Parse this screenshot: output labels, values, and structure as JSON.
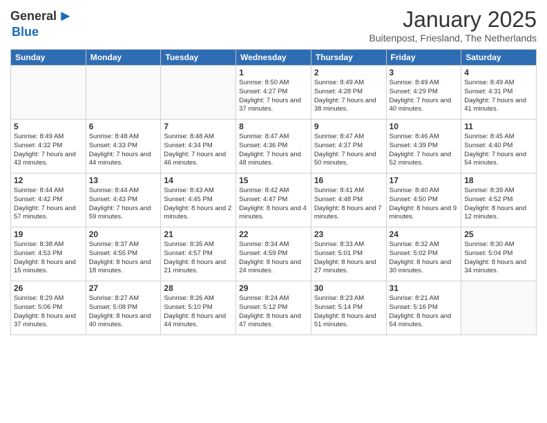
{
  "header": {
    "logo_general": "General",
    "logo_blue": "Blue",
    "title": "January 2025",
    "location": "Buitenpost, Friesland, The Netherlands"
  },
  "weekdays": [
    "Sunday",
    "Monday",
    "Tuesday",
    "Wednesday",
    "Thursday",
    "Friday",
    "Saturday"
  ],
  "weeks": [
    [
      {
        "day": "",
        "info": ""
      },
      {
        "day": "",
        "info": ""
      },
      {
        "day": "",
        "info": ""
      },
      {
        "day": "1",
        "info": "Sunrise: 8:50 AM\nSunset: 4:27 PM\nDaylight: 7 hours and 37 minutes."
      },
      {
        "day": "2",
        "info": "Sunrise: 8:49 AM\nSunset: 4:28 PM\nDaylight: 7 hours and 38 minutes."
      },
      {
        "day": "3",
        "info": "Sunrise: 8:49 AM\nSunset: 4:29 PM\nDaylight: 7 hours and 40 minutes."
      },
      {
        "day": "4",
        "info": "Sunrise: 8:49 AM\nSunset: 4:31 PM\nDaylight: 7 hours and 41 minutes."
      }
    ],
    [
      {
        "day": "5",
        "info": "Sunrise: 8:49 AM\nSunset: 4:32 PM\nDaylight: 7 hours and 43 minutes."
      },
      {
        "day": "6",
        "info": "Sunrise: 8:48 AM\nSunset: 4:33 PM\nDaylight: 7 hours and 44 minutes."
      },
      {
        "day": "7",
        "info": "Sunrise: 8:48 AM\nSunset: 4:34 PM\nDaylight: 7 hours and 46 minutes."
      },
      {
        "day": "8",
        "info": "Sunrise: 8:47 AM\nSunset: 4:36 PM\nDaylight: 7 hours and 48 minutes."
      },
      {
        "day": "9",
        "info": "Sunrise: 8:47 AM\nSunset: 4:37 PM\nDaylight: 7 hours and 50 minutes."
      },
      {
        "day": "10",
        "info": "Sunrise: 8:46 AM\nSunset: 4:39 PM\nDaylight: 7 hours and 52 minutes."
      },
      {
        "day": "11",
        "info": "Sunrise: 8:45 AM\nSunset: 4:40 PM\nDaylight: 7 hours and 54 minutes."
      }
    ],
    [
      {
        "day": "12",
        "info": "Sunrise: 8:44 AM\nSunset: 4:42 PM\nDaylight: 7 hours and 57 minutes."
      },
      {
        "day": "13",
        "info": "Sunrise: 8:44 AM\nSunset: 4:43 PM\nDaylight: 7 hours and 59 minutes."
      },
      {
        "day": "14",
        "info": "Sunrise: 8:43 AM\nSunset: 4:45 PM\nDaylight: 8 hours and 2 minutes."
      },
      {
        "day": "15",
        "info": "Sunrise: 8:42 AM\nSunset: 4:47 PM\nDaylight: 8 hours and 4 minutes."
      },
      {
        "day": "16",
        "info": "Sunrise: 8:41 AM\nSunset: 4:48 PM\nDaylight: 8 hours and 7 minutes."
      },
      {
        "day": "17",
        "info": "Sunrise: 8:40 AM\nSunset: 4:50 PM\nDaylight: 8 hours and 9 minutes."
      },
      {
        "day": "18",
        "info": "Sunrise: 8:39 AM\nSunset: 4:52 PM\nDaylight: 8 hours and 12 minutes."
      }
    ],
    [
      {
        "day": "19",
        "info": "Sunrise: 8:38 AM\nSunset: 4:53 PM\nDaylight: 8 hours and 15 minutes."
      },
      {
        "day": "20",
        "info": "Sunrise: 8:37 AM\nSunset: 4:55 PM\nDaylight: 8 hours and 18 minutes."
      },
      {
        "day": "21",
        "info": "Sunrise: 8:35 AM\nSunset: 4:57 PM\nDaylight: 8 hours and 21 minutes."
      },
      {
        "day": "22",
        "info": "Sunrise: 8:34 AM\nSunset: 4:59 PM\nDaylight: 8 hours and 24 minutes."
      },
      {
        "day": "23",
        "info": "Sunrise: 8:33 AM\nSunset: 5:01 PM\nDaylight: 8 hours and 27 minutes."
      },
      {
        "day": "24",
        "info": "Sunrise: 8:32 AM\nSunset: 5:02 PM\nDaylight: 8 hours and 30 minutes."
      },
      {
        "day": "25",
        "info": "Sunrise: 8:30 AM\nSunset: 5:04 PM\nDaylight: 8 hours and 34 minutes."
      }
    ],
    [
      {
        "day": "26",
        "info": "Sunrise: 8:29 AM\nSunset: 5:06 PM\nDaylight: 8 hours and 37 minutes."
      },
      {
        "day": "27",
        "info": "Sunrise: 8:27 AM\nSunset: 5:08 PM\nDaylight: 8 hours and 40 minutes."
      },
      {
        "day": "28",
        "info": "Sunrise: 8:26 AM\nSunset: 5:10 PM\nDaylight: 8 hours and 44 minutes."
      },
      {
        "day": "29",
        "info": "Sunrise: 8:24 AM\nSunset: 5:12 PM\nDaylight: 8 hours and 47 minutes."
      },
      {
        "day": "30",
        "info": "Sunrise: 8:23 AM\nSunset: 5:14 PM\nDaylight: 8 hours and 51 minutes."
      },
      {
        "day": "31",
        "info": "Sunrise: 8:21 AM\nSunset: 5:16 PM\nDaylight: 8 hours and 54 minutes."
      },
      {
        "day": "",
        "info": ""
      }
    ]
  ]
}
